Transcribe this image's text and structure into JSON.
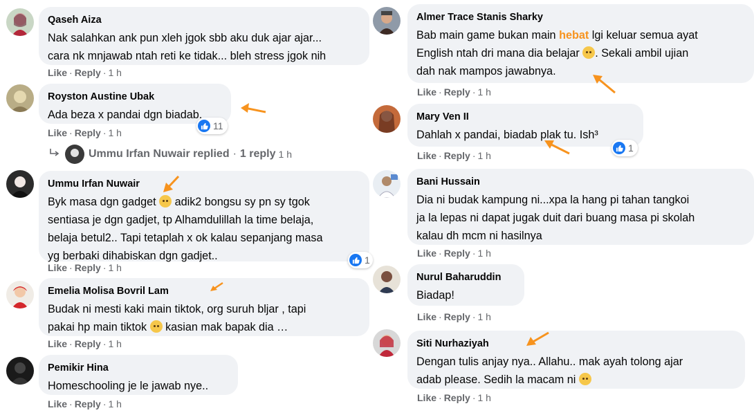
{
  "actions": {
    "like": "Like",
    "reply": "Reply",
    "sep": "·"
  },
  "colors": {
    "bubble": "#f0f2f5",
    "accent_arrow": "#f7931e",
    "like_blue": "#1877f2",
    "meta_gray": "#65676b"
  },
  "left": [
    {
      "author": "Qaseh Aiza",
      "text": "Nak salahkan ank pun xleh jgok sbb aku duk ajar ajar...\ncara nk mnjawab ntah reti ke tidak... bleh stress jgok nih",
      "time": "1 h"
    },
    {
      "author": "Royston Austine Ubak",
      "text": "Ada beza x pandai dgn biadab.",
      "time": "1 h",
      "reactions": "11"
    },
    {
      "reply_line": {
        "name": "Ummu Irfan Nuwair replied",
        "sep": "·",
        "count": "1 reply",
        "time": "1 h"
      }
    },
    {
      "author": "Ummu Irfan Nuwair",
      "text_a": "Byk masa dgn gadget",
      "text_b": " adik2 bongsu sy pn sy tgok\nsentiasa je dgn gadjet, tp Alhamdulillah la time belaja,\nbelaja betul2.. Tapi tetaplah x ok kalau sepanjang masa\nyg berbaki dihabiskan dgn gadjet..",
      "time": "1 h",
      "reactions": "1"
    },
    {
      "author": "Emelia Molisa Bovril Lam",
      "text_a": "Budak ni mesti kaki main tiktok, org suruh bljar , tapi\npakai hp main tiktok",
      "text_b": " kasian mak bapak dia …",
      "time": "1 h"
    },
    {
      "author": "Pemikir Hina",
      "text": "Homeschooling je le jawab nye..",
      "time": "1 h"
    }
  ],
  "right": [
    {
      "author": "Almer Trace Stanis Sharky",
      "text_a": "Bab main game bukan main ",
      "highlight": "hebat",
      "text_b": " lgi keluar semua ayat\nEnglish ntah dri mana dia belajar",
      "text_c": ". Sekali ambil ujian\ndah nak mampos jawabnya.",
      "time": "1 h"
    },
    {
      "author": "Mary Ven II",
      "text": "Dahlah x pandai, biadab plak tu. Ish³",
      "time": "1 h",
      "reactions": "1"
    },
    {
      "author": "Bani Hussain",
      "text": "Dia ni budak kampung ni...xpa la hang pi tahan tangkoi\nja la lepas ni dapat jugak duit dari buang masa pi skolah\nkalau dh mcm ni hasilnya",
      "time": "1 h"
    },
    {
      "author": "Nurul Baharuddin",
      "text": "Biadap!",
      "time": "1 h"
    },
    {
      "author": "Siti Nurhaziyah",
      "text_a": "Dengan tulis anjay nya.. Allahu.. mak ayah tolong ajar\nadab please. Sedih la macam ni",
      "text_b": "",
      "time": "1 h"
    }
  ]
}
